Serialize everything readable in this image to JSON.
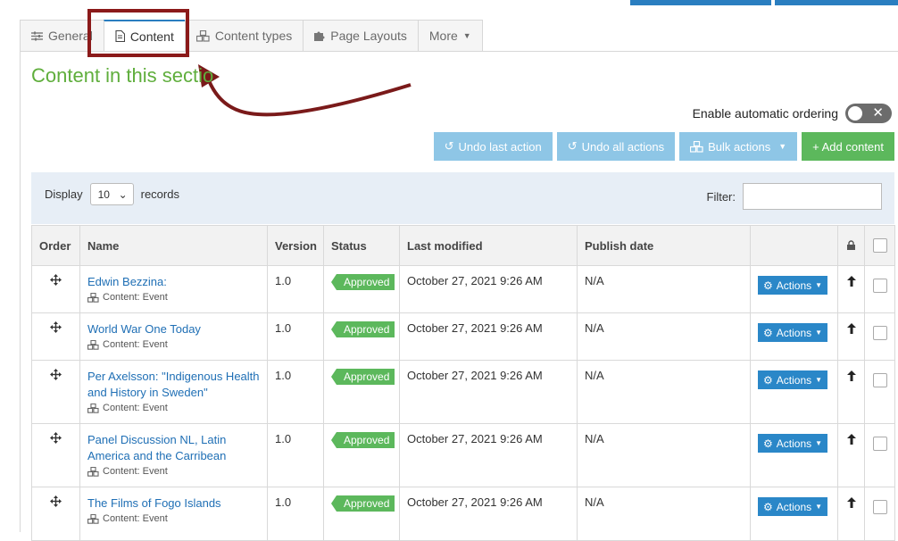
{
  "tabs": [
    {
      "label": "General",
      "icon": "sliders-icon"
    },
    {
      "label": "Content",
      "icon": "document-icon"
    },
    {
      "label": "Content types",
      "icon": "cubes-icon"
    },
    {
      "label": "Page Layouts",
      "icon": "puzzle-icon"
    },
    {
      "label": "More",
      "icon": "caret-down-icon"
    }
  ],
  "section_title": "Content in this sectio",
  "auto_ordering_label": "Enable automatic ordering",
  "buttons": {
    "undo_last": "Undo last action",
    "undo_all": "Undo all actions",
    "bulk": "Bulk actions",
    "add": "+ Add content"
  },
  "display": {
    "label": "Display",
    "value": "10",
    "suffix": "records"
  },
  "filter_label": "Filter:",
  "columns": [
    "Order",
    "Name",
    "Version",
    "Status",
    "Last modified",
    "Publish date"
  ],
  "rows": [
    {
      "name": "Edwin Bezzina:",
      "type": "Content: Event",
      "version": "1.0",
      "status": "Approved",
      "modified": "October 27, 2021 9:26 AM",
      "publish": "N/A",
      "actions": "Actions"
    },
    {
      "name": "World War One Today",
      "type": "Content: Event",
      "version": "1.0",
      "status": "Approved",
      "modified": "October 27, 2021 9:26 AM",
      "publish": "N/A",
      "actions": "Actions"
    },
    {
      "name": "Per Axelsson: \"Indigenous Health and History in Sweden\"",
      "type": "Content: Event",
      "version": "1.0",
      "status": "Approved",
      "modified": "October 27, 2021 9:26 AM",
      "publish": "N/A",
      "actions": "Actions"
    },
    {
      "name": "Panel Discussion NL, Latin America and the Carribean",
      "type": "Content: Event",
      "version": "1.0",
      "status": "Approved",
      "modified": "October 27, 2021 9:26 AM",
      "publish": "N/A",
      "actions": "Actions"
    },
    {
      "name": "The Films of Fogo Islands",
      "type": "Content: Event",
      "version": "1.0",
      "status": "Approved",
      "modified": "October 27, 2021 9:26 AM",
      "publish": "N/A",
      "actions": "Actions"
    }
  ],
  "colors": {
    "accent": "#2a7ec0",
    "title_green": "#5fae3c",
    "approved": "#5cb85c",
    "highlight": "#8b1a1a"
  }
}
